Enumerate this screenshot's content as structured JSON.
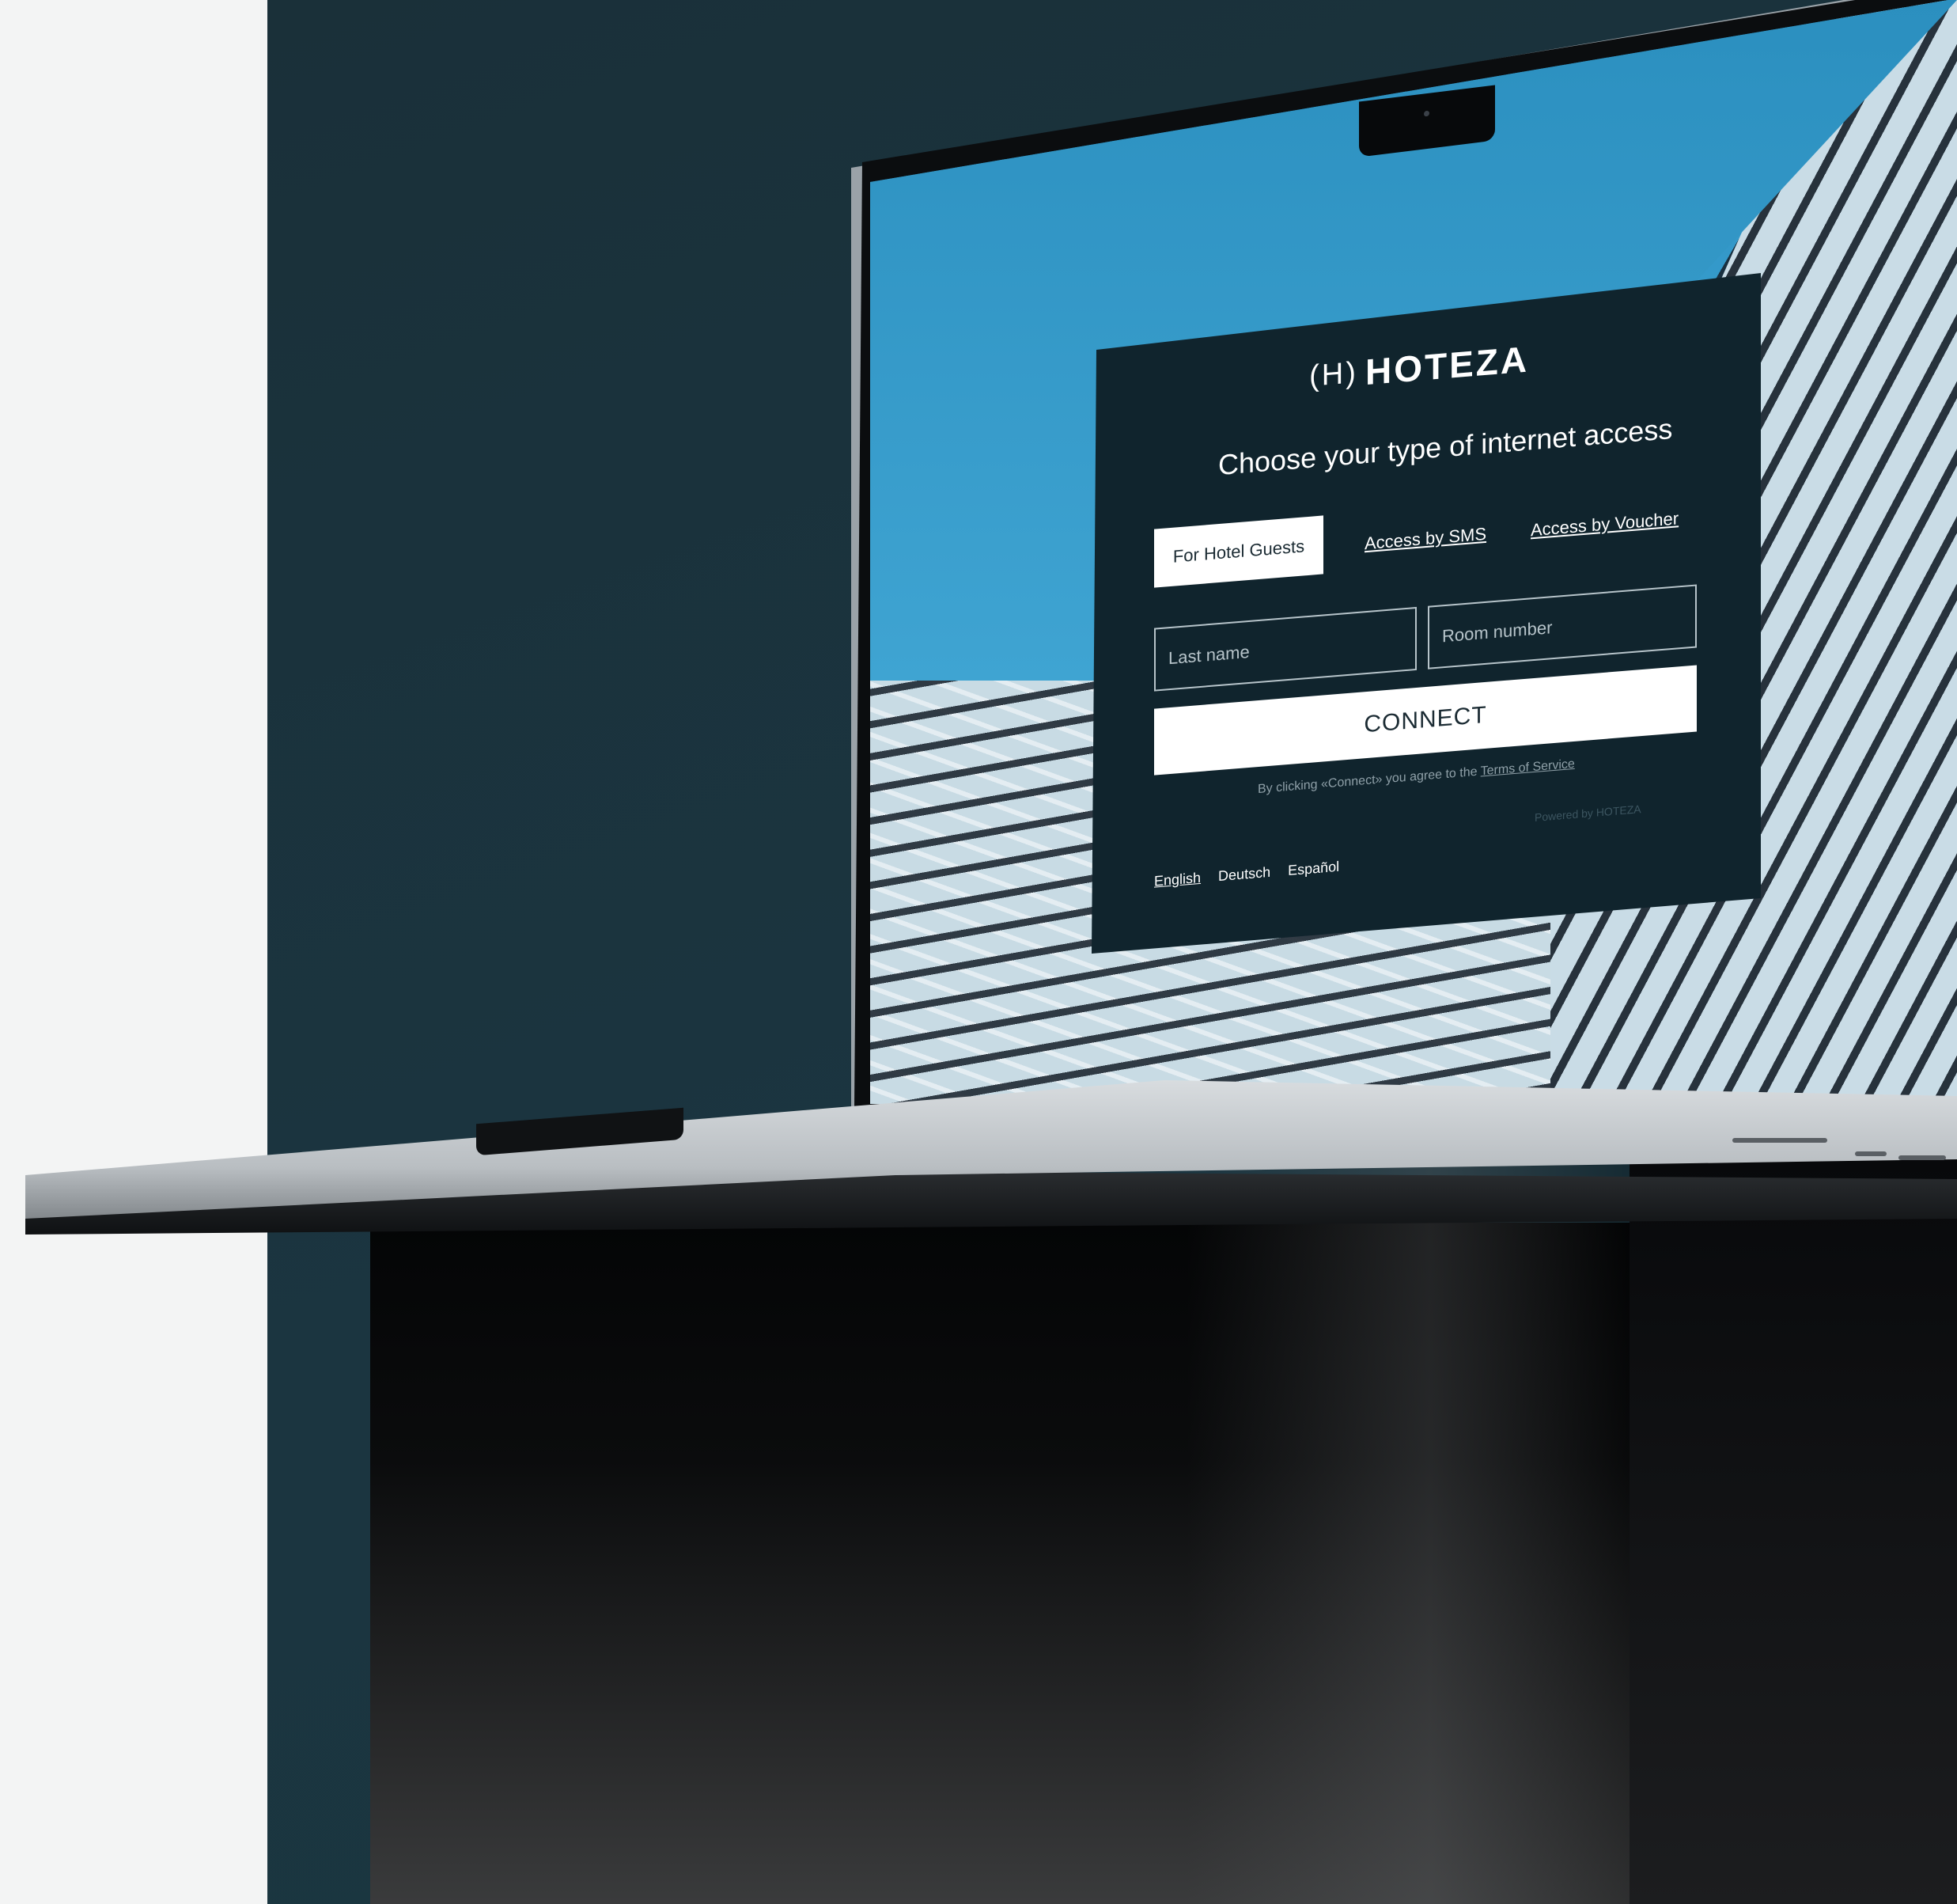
{
  "portal": {
    "brand": "HOTEZA",
    "brand_mark": "(H)",
    "heading": "Choose your type of internet access",
    "tabs": [
      {
        "label": "For Hotel Guests",
        "active": true
      },
      {
        "label": "Access by SMS",
        "active": false
      },
      {
        "label": "Access by Voucher",
        "active": false
      }
    ],
    "fields": {
      "last_name_placeholder": "Last name",
      "room_number_placeholder": "Room number"
    },
    "connect_label": "CONNECT",
    "terms_prefix": "By clicking «Connect» you agree to the",
    "terms_link": "Terms of Service",
    "powered_by": "Powered by HOTEZA",
    "languages": [
      {
        "label": "English",
        "active": true
      },
      {
        "label": "Deutsch",
        "active": false
      },
      {
        "label": "Español",
        "active": false
      }
    ]
  },
  "colors": {
    "panel": "#10242d",
    "background_dark": "#1a3039",
    "background_light": "#f3f4f4",
    "button": "#ffffff"
  }
}
